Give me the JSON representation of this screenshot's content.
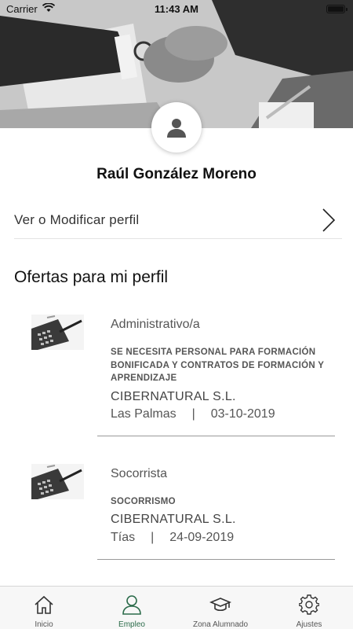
{
  "status_bar": {
    "carrier": "Carrier",
    "time": "11:43 AM"
  },
  "user": {
    "name": "Raúl González Moreno"
  },
  "profile_link": {
    "label": "Ver o Modificar perfil"
  },
  "offers_section": {
    "title": "Ofertas para mi perfil"
  },
  "offers": [
    {
      "role": "Administrativo/a",
      "description": "SE NECESITA PERSONAL PARA FORMACIÓN BONIFICADA Y CONTRATOS DE FORMACIÓN Y APRENDIZAJE",
      "company": "CIBERNATURAL S.L.",
      "location": "Las Palmas",
      "separator": "|",
      "date": "03-10-2019"
    },
    {
      "role": "Socorrista",
      "description": "SOCORRISMO",
      "company": "CIBERNATURAL S.L.",
      "location": "Tías",
      "separator": "|",
      "date": "24-09-2019"
    }
  ],
  "tabbar": {
    "items": [
      {
        "label": "Inicio",
        "icon": "home-icon"
      },
      {
        "label": "Empleo",
        "icon": "person-icon",
        "active": true
      },
      {
        "label": "Zona Alumnado",
        "icon": "graduation-cap-icon"
      },
      {
        "label": "Ajustes",
        "icon": "gear-icon"
      }
    ]
  },
  "colors": {
    "active_tab": "#2b6b4a",
    "divider": "#9a9a9a"
  }
}
